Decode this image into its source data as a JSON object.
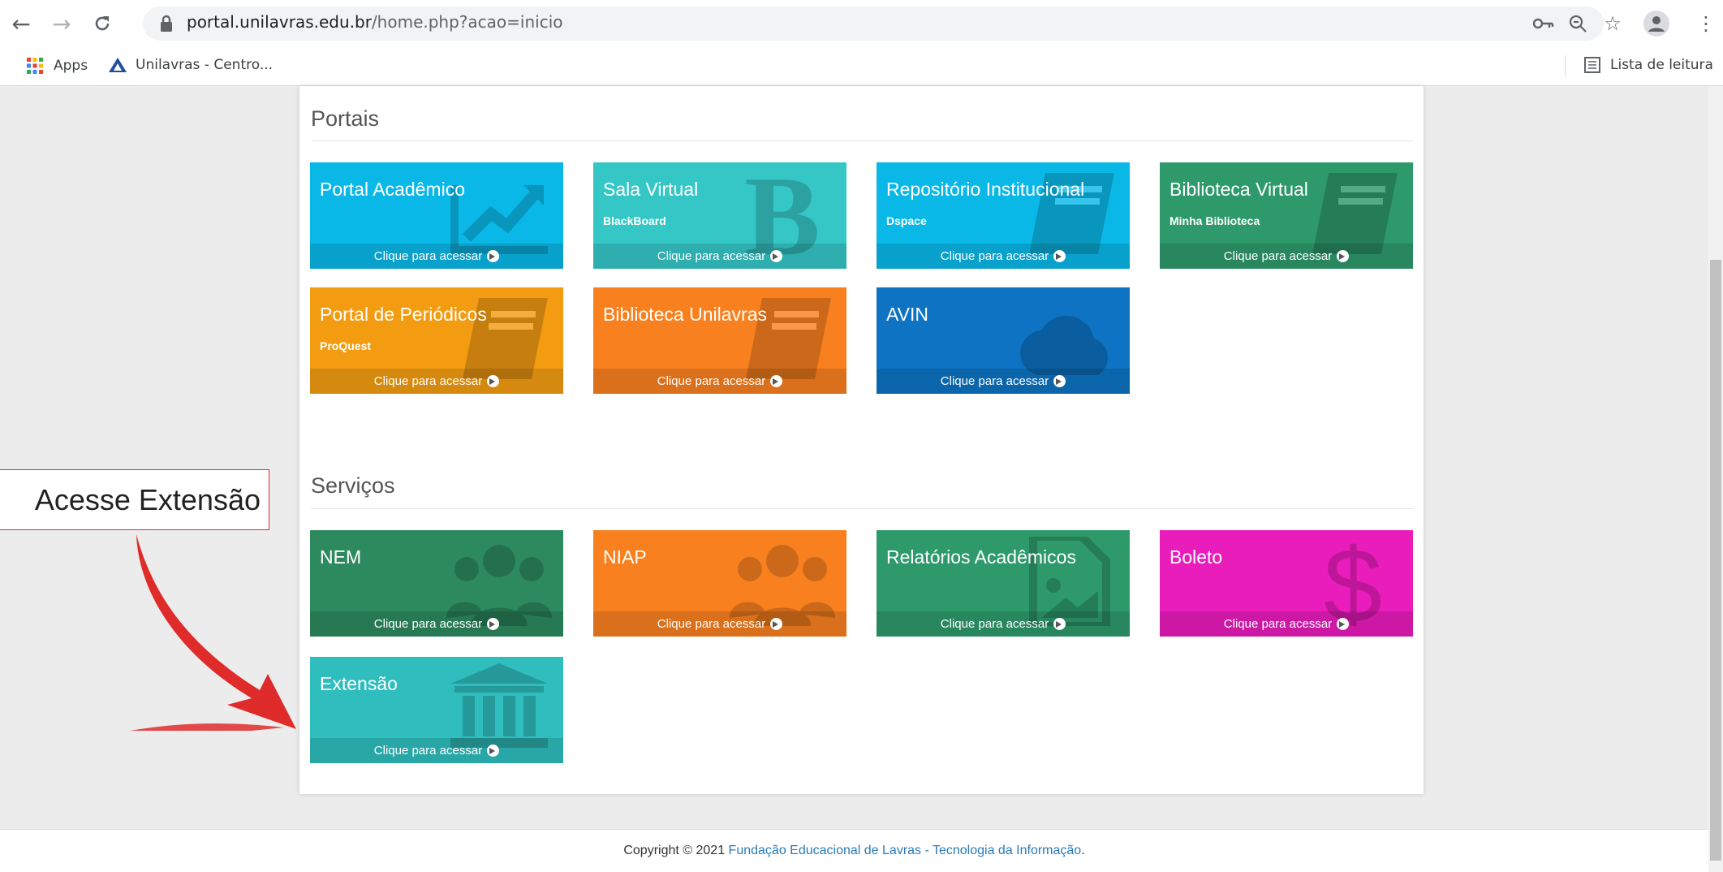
{
  "browser": {
    "url_host": "portal.unilavras.edu.br",
    "url_path": "/home.php?acao=inicio",
    "bookmarks": [
      {
        "label": "Apps"
      },
      {
        "label": "Unilavras - Centro..."
      }
    ],
    "reading_list": "Lista de leitura"
  },
  "portais": {
    "title": "Portais",
    "tiles": [
      {
        "title": "Portal Acadêmico",
        "subtitle": "",
        "cta": "Clique para acessar",
        "color": "#0ab8e8",
        "icon": "chart-line-icon"
      },
      {
        "title": "Sala Virtual",
        "subtitle": "BlackBoard",
        "cta": "Clique para acessar",
        "color": "#35c6c6",
        "icon": "blackboard-b-icon"
      },
      {
        "title": "Repositório Institucional",
        "subtitle": "Dspace",
        "cta": "Clique para acessar",
        "color": "#0ab8e8",
        "icon": "book-icon"
      },
      {
        "title": "Biblioteca Virtual",
        "subtitle": "Minha Biblioteca",
        "cta": "Clique para acessar",
        "color": "#2e9a6c",
        "icon": "book-icon"
      },
      {
        "title": "Portal de Periódicos",
        "subtitle": "ProQuest",
        "cta": "Clique para acessar",
        "color": "#f39c12",
        "icon": "book-icon"
      },
      {
        "title": "Biblioteca Unilavras",
        "subtitle": "",
        "cta": "Clique para acessar",
        "color": "#f9801f",
        "icon": "book-icon"
      },
      {
        "title": "AVIN",
        "subtitle": "",
        "cta": "Clique para acessar",
        "color": "#0d73c2",
        "icon": "cloud-icon"
      }
    ]
  },
  "servicos": {
    "title": "Serviços",
    "tiles": [
      {
        "title": "NEM",
        "subtitle": "",
        "cta": "Clique para acessar",
        "color": "#2d8a5f",
        "icon": "users-icon"
      },
      {
        "title": "NIAP",
        "subtitle": "",
        "cta": "Clique para acessar",
        "color": "#f9801f",
        "icon": "users-icon"
      },
      {
        "title": "Relatórios Acadêmicos",
        "subtitle": "",
        "cta": "Clique para acessar",
        "color": "#2e9a6c",
        "icon": "file-image-icon"
      },
      {
        "title": "Boleto",
        "subtitle": "",
        "cta": "Clique para acessar",
        "color": "#e91cbc",
        "icon": "dollar-icon"
      },
      {
        "title": "Extensão",
        "subtitle": "",
        "cta": "Clique para acessar",
        "color": "#2fbdbd",
        "icon": "institution-icon"
      }
    ]
  },
  "footer": {
    "prefix": "Copyright © 2021 ",
    "link": "Fundação Educacional de Lavras - Tecnologia da Informação",
    "suffix": "."
  },
  "annotation": {
    "callout": "Acesse Extensão",
    "color": "#e02b2b"
  }
}
